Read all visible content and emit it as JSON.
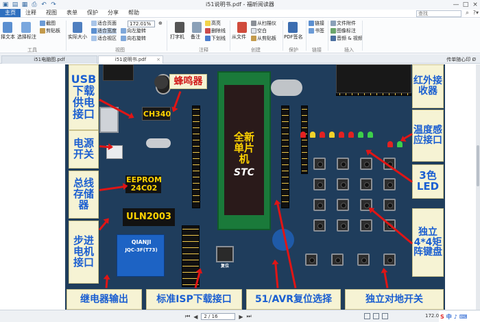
{
  "window": {
    "title": "i51说明书.pdf - 福昕阅读器",
    "controls": [
      "—",
      "□",
      "×"
    ]
  },
  "ribbon_tabs": [
    {
      "label": "主页",
      "active": true
    },
    {
      "label": "注释",
      "active": false
    },
    {
      "label": "视图",
      "active": false
    },
    {
      "label": "表单",
      "active": false
    },
    {
      "label": "保护",
      "active": false
    },
    {
      "label": "分享",
      "active": false
    },
    {
      "label": "帮助",
      "active": false
    }
  ],
  "search": {
    "placeholder": "查找"
  },
  "ribbon": {
    "tools": {
      "hand": "择文本",
      "select_annot": "选择标注",
      "snapshot": "截图",
      "clipboard": "剪贴板",
      "group": "工具"
    },
    "view": {
      "actual_size": "实际大小",
      "fit_page": "适合页面",
      "fit_width": "适合宽度",
      "fit_visible": "适合视区",
      "rotate_left": "向左旋转",
      "rotate_right": "向右旋转",
      "zoom": "172.01%",
      "group": "视图"
    },
    "comment": {
      "typewriter": "打字机",
      "note": "备注",
      "highlight": "高亮",
      "strikeout": "删除线",
      "underline": "下划线",
      "group": "注释"
    },
    "create": {
      "from_file": "从文件",
      "from_scanner": "从扫描仪",
      "blank": "空白",
      "from_clipboard": "从剪贴板",
      "group": "创建"
    },
    "protect": {
      "pdf_sign": "PDF签名",
      "group": "保护"
    },
    "links": {
      "link": "链接",
      "bookmark": "书签",
      "group": "链接"
    },
    "insert": {
      "file_attachment": "文件附件",
      "image_annotation": "图像标注",
      "audio_video": "音频 & 视频",
      "group": "插入"
    }
  },
  "doc_tabs": [
    {
      "label": "i51电脑图.pdf",
      "active": false
    },
    {
      "label": "i51说明书.pdf",
      "active": true
    }
  ],
  "side_note": "传单随心印 Ø",
  "board_labels": {
    "usb": "USB下载供电接口",
    "buzzer": "蜂鸣器",
    "ch340": "CH340",
    "new_mcu": "全新单片机",
    "ir": "红外接收器",
    "temp": "温度感应接口",
    "power": "电源开关",
    "led3": "3色LED",
    "bus": "总线存储器",
    "eeprom": "EEPROM 24C02",
    "uln": "ULN2003",
    "stepper": "步进电机接口",
    "matrix": "独立4*4矩阵键盘",
    "relay": "继电器输出",
    "isp": "标准ISP下载接口",
    "reset": "51/AVR复位选择",
    "keys": "独立对地开关",
    "relay_brand": "QIANJI",
    "relay_model": "JQC-3F(T73)",
    "stc": "STC",
    "reset_key": "复位"
  },
  "statusbar": {
    "page": "2 / 16",
    "zoom": "172.01%",
    "tray": [
      "S",
      "中",
      "♪",
      "⌨"
    ]
  },
  "colors": {
    "accent": "#2e6fbf",
    "label_blue": "#1b5fd1",
    "label_red": "#d11b1b",
    "arrow_red": "#e01515",
    "board": "#1f3d5c"
  }
}
